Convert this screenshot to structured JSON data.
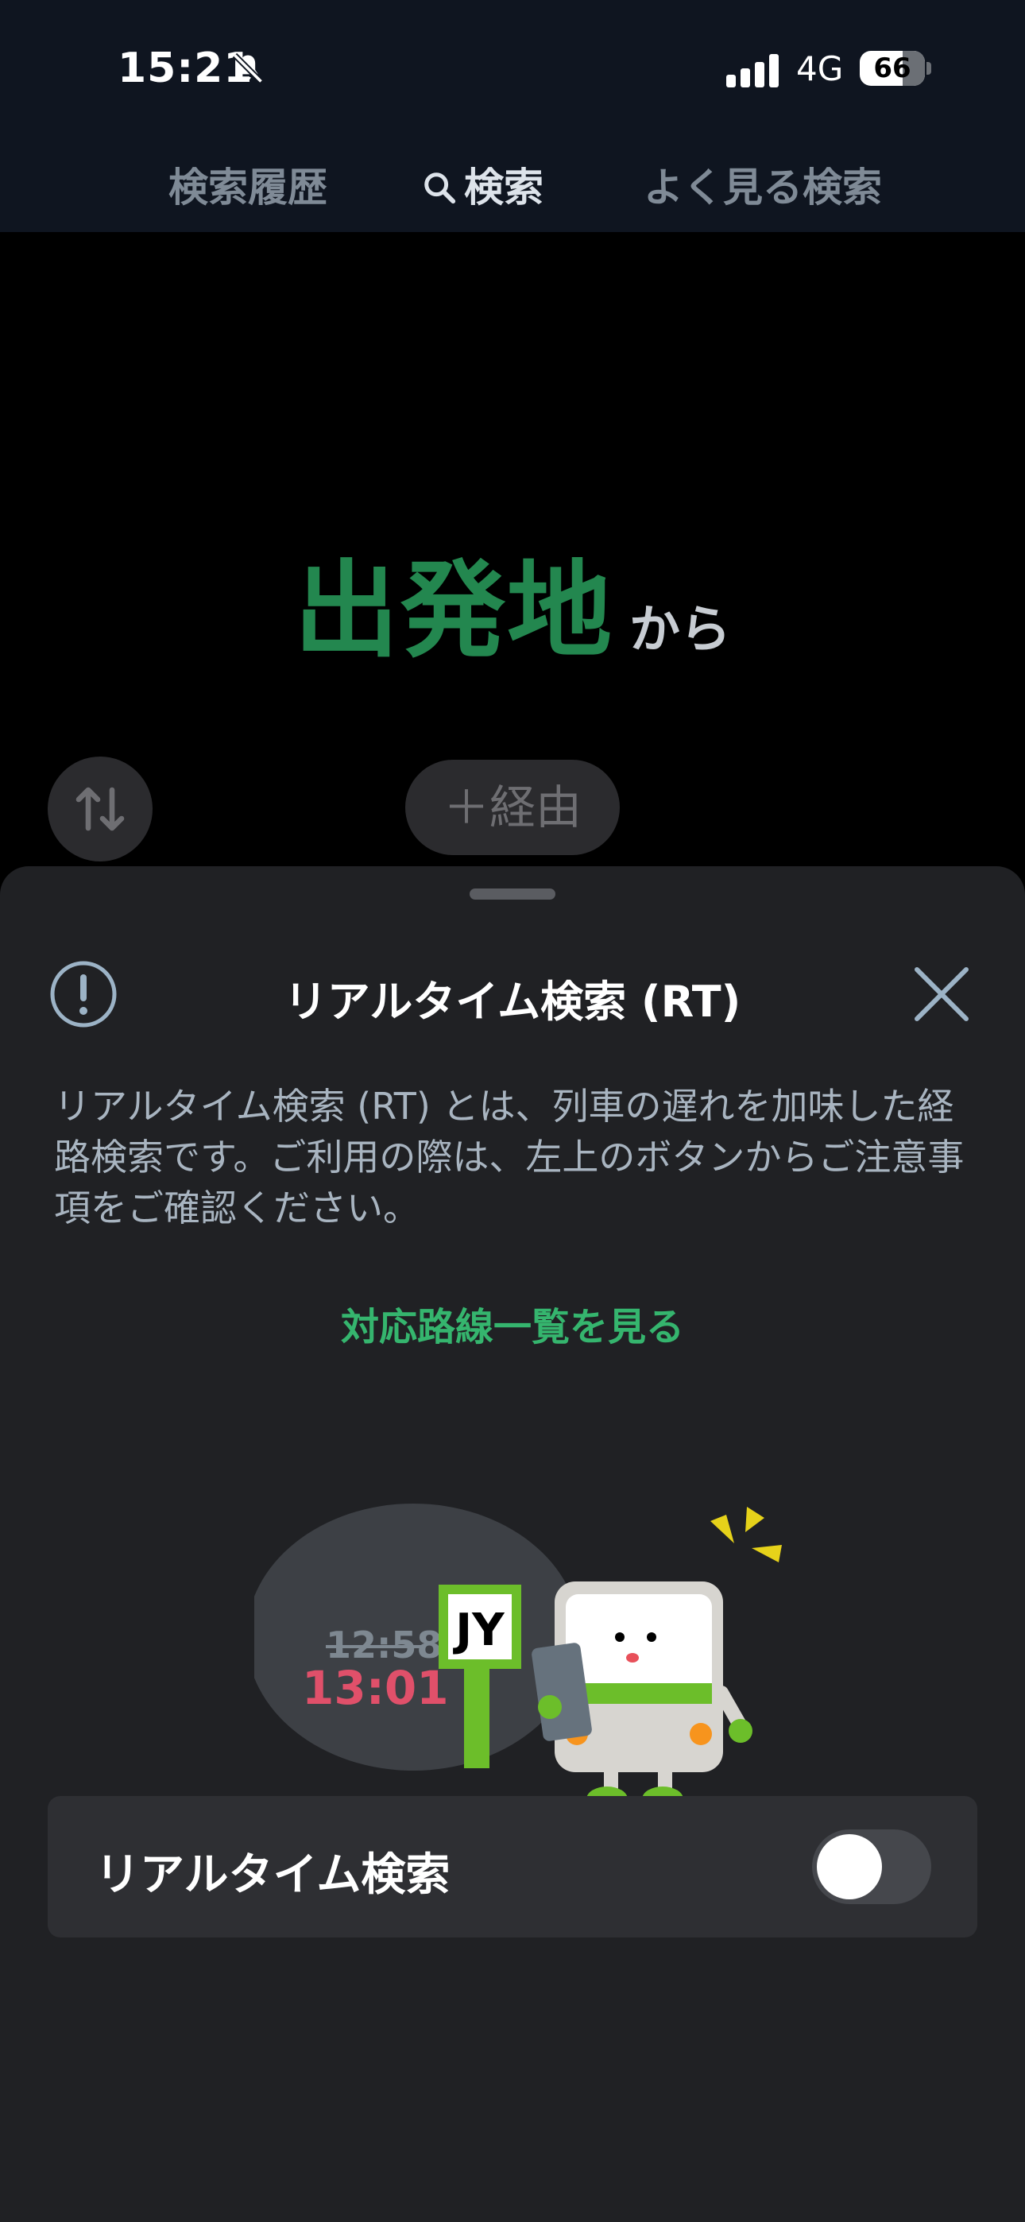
{
  "status_bar": {
    "time": "15:21",
    "network": "4G",
    "battery": "66",
    "battery_level": 0.66,
    "bell_icon": "bell-muted-icon"
  },
  "tabs": {
    "history": "検索履歴",
    "search": "検索",
    "frequent": "よく見る検索",
    "active": "search"
  },
  "main": {
    "origin_label": "出発地",
    "origin_suffix": "から",
    "via_label": "＋経由",
    "swap_icon": "swap-vertical-icon"
  },
  "sheet": {
    "title": "リアルタイム検索 (RT)",
    "description": "リアルタイム検索 (RT) とは、列車の遅れを加味した経路検索です。ご利用の際は、左上のボタンからご注意事項をご確認ください。",
    "route_list_link": "対応路線一覧を見る",
    "illustration": {
      "old_time": "12:58",
      "new_time": "13:01",
      "line_code": "JY"
    },
    "toggle_label": "リアルタイム検索",
    "toggle_on": false
  },
  "colors": {
    "accent_green": "#23874f",
    "link_green": "#35b56e",
    "delay_red": "#e0506a",
    "sheet_bg": "#202124"
  }
}
